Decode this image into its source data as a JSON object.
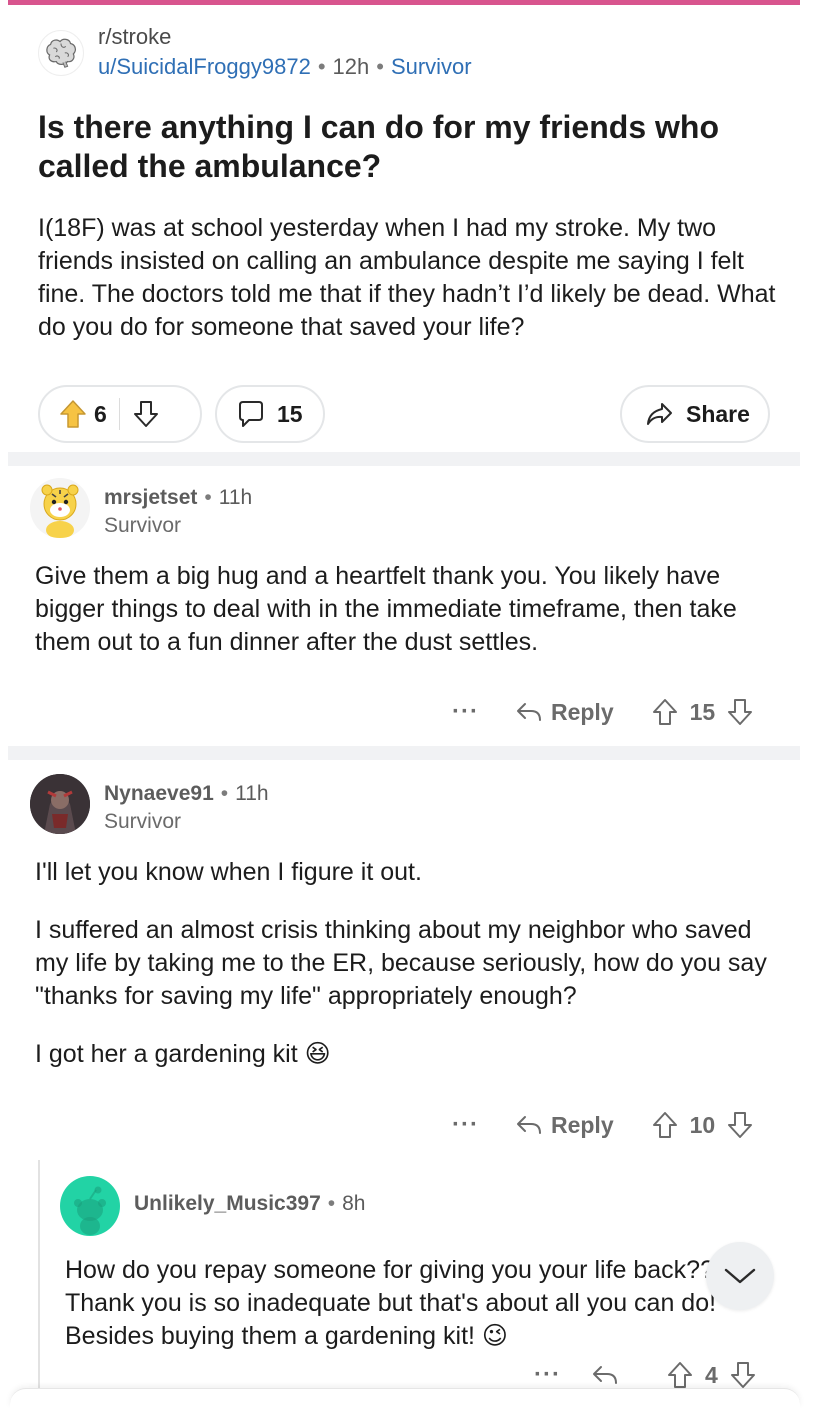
{
  "post": {
    "subreddit": "r/stroke",
    "author": "u/SuicidalFroggy9872",
    "time": "12h",
    "flair": "Survivor",
    "title": "Is there anything I can do for my friends who called the ambulance?",
    "body": "I(18F) was at school yesterday when I had my stroke. My two friends insisted on calling an ambulance despite me saying I felt fine. The doctors told me that if they hadn’t I’d likely be dead. What do you do for someone that saved your life?",
    "votes": "6",
    "comments": "15",
    "share_label": "Share"
  },
  "comments": [
    {
      "author": "mrsjetset",
      "time": "11h",
      "flair": "Survivor",
      "paragraphs": [
        "Give them a big hug and a heartfelt thank you.  You likely have bigger things to deal with in the immediate timeframe, then take them out to a fun dinner after the dust settles."
      ],
      "reply_label": "Reply",
      "votes": "15",
      "more": "···"
    },
    {
      "author": "Nynaeve91",
      "time": "11h",
      "flair": "Survivor",
      "paragraphs": [
        "I'll let you know when I figure it out.",
        "I suffered an almost crisis thinking about my neighbor who saved my life by taking me to the ER, because seriously, how do you say \"thanks for saving my life\" appropriately enough?",
        "I got her a gardening kit 😆"
      ],
      "reply_label": "Reply",
      "votes": "10",
      "more": "···"
    },
    {
      "author": "Unlikely_Music397",
      "time": "8h",
      "paragraphs": [
        "How do you repay someone for giving you your life back?? Thank you is so inadequate but that's about all you can do! Besides buying them a gardening kit! 😉"
      ],
      "votes": "4",
      "more": "···"
    }
  ],
  "icons": {
    "upvote": "upvote-arrow-icon",
    "downvote": "downvote-arrow-icon",
    "comment": "comment-bubble-icon",
    "share": "share-arrow-icon",
    "reply": "reply-arrow-icon",
    "scroll": "chevron-down-icon"
  },
  "colors": {
    "accent_bar": "#d8558e",
    "link": "#2f6fb5",
    "upvote_fill": "#f6c343",
    "reply_avatar_bg": "#22d3a5"
  }
}
